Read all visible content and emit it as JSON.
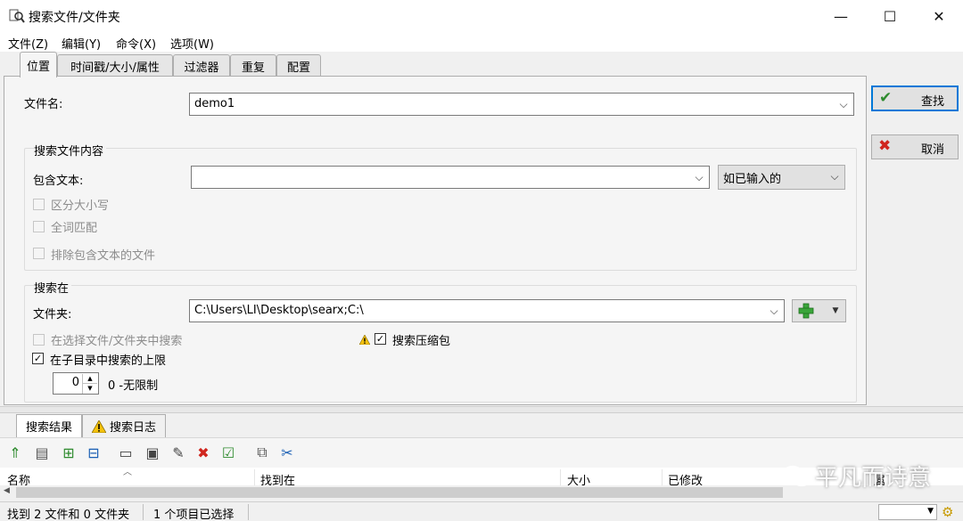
{
  "window": {
    "title": "搜索文件/文件夹",
    "controls": {
      "minimize": "—",
      "maximize": "☐",
      "close": "✕"
    }
  },
  "menu": [
    {
      "label": "文件(Z)"
    },
    {
      "label": "编辑(Y)"
    },
    {
      "label": "命令(X)"
    },
    {
      "label": "选项(W)"
    }
  ],
  "tabs": [
    {
      "label": "位置",
      "active": true
    },
    {
      "label": "时间戳/大小/属性"
    },
    {
      "label": "过滤器"
    },
    {
      "label": "重复"
    },
    {
      "label": "配置"
    }
  ],
  "location": {
    "filename_label": "文件名:",
    "filename_value": "demo1",
    "content_group": {
      "title": "搜索文件内容",
      "contains_label": "包含文本:",
      "contains_value": "",
      "encoding_value": "如已输入的",
      "case_sensitive": {
        "label": "区分大小写",
        "checked": false,
        "enabled": false
      },
      "whole_word": {
        "label": "全词匹配",
        "checked": false,
        "enabled": false
      },
      "exclude_matching": {
        "label": "排除包含文本的文件",
        "checked": false,
        "enabled": false
      }
    },
    "search_in": {
      "title": "搜索在",
      "folder_label": "文件夹:",
      "folder_value": "C:\\Users\\LI\\Desktop\\searx;C:\\",
      "in_selection": {
        "label": "在选择文件/文件夹中搜索",
        "checked": false,
        "enabled": false
      },
      "archives": {
        "label": "搜索压缩包",
        "checked": true
      },
      "subdir_limit": {
        "label": "在子目录中搜索的上限",
        "checked": true
      },
      "depth_value": "0",
      "depth_hint": "0 -无限制"
    }
  },
  "actions": {
    "find": "查找",
    "cancel": "取消"
  },
  "bottom_tabs": [
    {
      "label": "搜索结果",
      "active": true
    },
    {
      "label": "搜索日志"
    }
  ],
  "result_columns": [
    "名称",
    "找到在",
    "大小",
    "已修改",
    "属"
  ],
  "status": {
    "summary": "找到 2 文件和 0 文件夹",
    "selection": "1 个项目已选择"
  },
  "watermark": "平凡而诗意",
  "colors": {
    "accent": "#0078d7",
    "check_green": "#2e8b2e",
    "cancel_red": "#d0261e"
  }
}
